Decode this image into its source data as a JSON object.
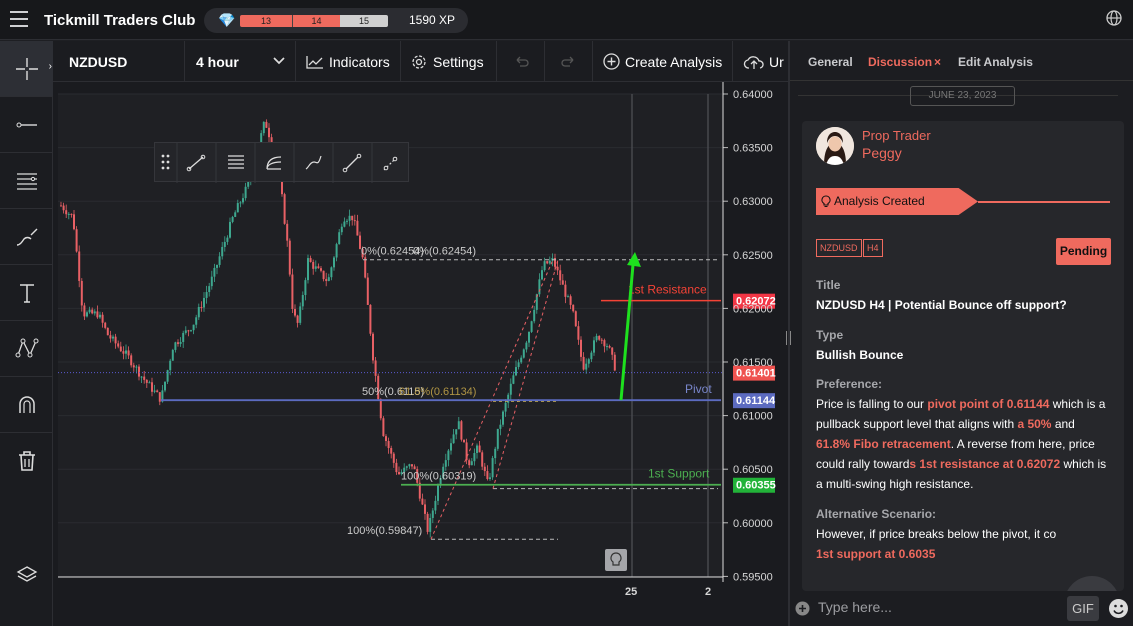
{
  "header": {
    "brand": "Tickmill Traders Club",
    "xp": {
      "bar1": "13",
      "bar2": "14",
      "bar3": "15",
      "total": "1590 XP"
    }
  },
  "toolbar": {
    "symbol": "NZDUSD",
    "timeframe": "4 hour",
    "indicators": "Indicators",
    "settings": "Settings",
    "create_analysis": "Create Analysis",
    "upload": "Ur"
  },
  "chart": {
    "price_axis": [
      "0.64000",
      "0.63500",
      "0.63000",
      "0.62500",
      "0.62000",
      "0.61500",
      "0.61000",
      "0.60500",
      "0.60000",
      "0.59500"
    ],
    "time_axis": [
      "25",
      "2"
    ],
    "fib_labels": {
      "top_a": "0%(0.62454)",
      "top_b": "0%(0.62454)",
      "mid_a": "50%(0.6115)",
      "mid_b": "61.8%(0.61134)",
      "low_a": "100%(0.60319)",
      "low_b": "100%(0.59847)"
    },
    "levels": {
      "resistance": {
        "label": "1st Resistance",
        "price": "0.62072",
        "color": "#f44336"
      },
      "pivot": {
        "label": "Pivot",
        "price": "0.61144",
        "color": "#5c6bc0"
      },
      "support": {
        "label": "1st Support",
        "price": "0.60355",
        "color": "#4caf50"
      },
      "current_price": {
        "price": "0.61401",
        "color": "#ef5350"
      }
    }
  },
  "panel": {
    "tabs": [
      "General",
      "Discussion",
      "Edit Analysis"
    ],
    "active_tab": "Discussion",
    "date": "JUNE 23, 2023",
    "post": {
      "role": "Prop Trader",
      "user": "Peggy",
      "status_banner": "Analysis Created",
      "tags": [
        "NZDUSD",
        "H4"
      ],
      "pending": "Pending",
      "title_label": "Title",
      "title": "NZDUSD H4 | Potential Bounce off support?",
      "type_label": "Type",
      "type": "Bullish Bounce",
      "preference_label": "Preference:",
      "pref_1": "Price is falling to our ",
      "pref_2": "pivot point of 0.61144",
      "pref_3": " which is a pullback support level that aligns with ",
      "pref_4": "a 50%",
      "pref_5": " and ",
      "pref_6": "61.8% Fibo retracement",
      "pref_7": ". A reverse from here, price could rally toward",
      "pref_8": "s 1st resistance at 0.62072",
      "pref_9": " which is a multi-swing high resistance.",
      "alt_label": "Alternative Scenario:",
      "alt_1": "However, if price breaks below the pivot, it co",
      "alt_2": "1st support at 0.6035"
    },
    "compose_placeholder": "Type here...",
    "gif": "GIF"
  }
}
